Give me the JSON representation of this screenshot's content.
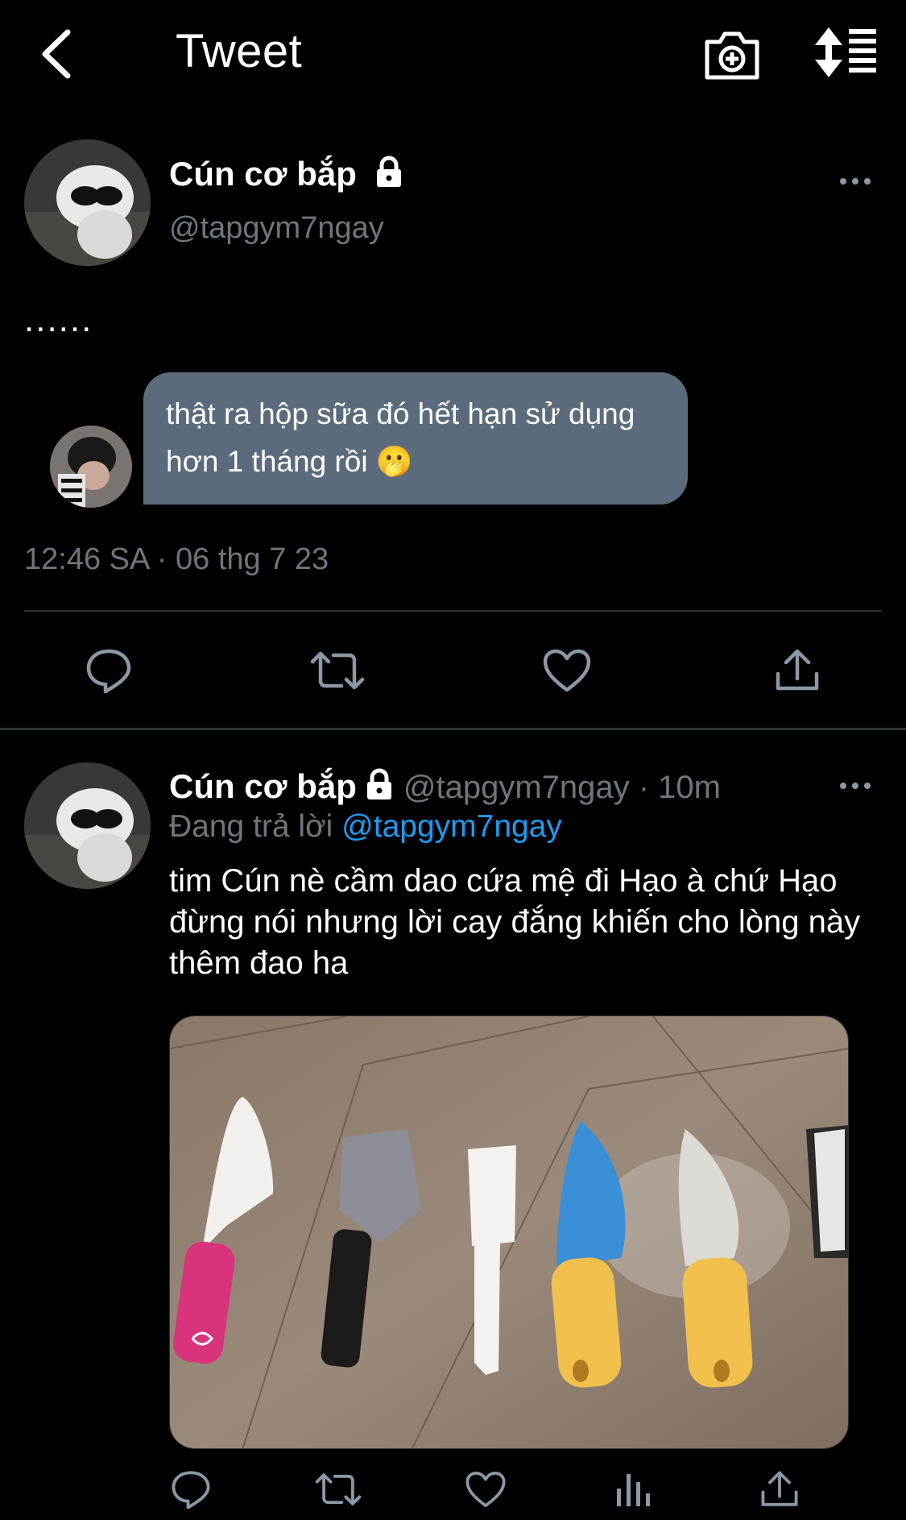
{
  "header": {
    "title": "Tweet"
  },
  "main_tweet": {
    "author_name": "Cún cơ bắp",
    "handle": "@tapgym7ngay",
    "text": "......",
    "dm_message": "thật ra hộp sữa đó hết hạn sử dụng hơn 1 tháng rồi 🫢",
    "timestamp": "12:46 SA · 06 thg 7 23"
  },
  "reply": {
    "author_name": "Cún cơ bắp",
    "meta": "@tapgym7ngay · 10m",
    "replying_label": "Đang trả lời ",
    "replying_to": "@tapgym7ngay",
    "text": "tim Cún nè cầm dao cứa mệ đi Hạo à chứ Hạo đừng nói nhưng lời cay đắng khiến cho lòng này thêm đao ha"
  },
  "colors": {
    "background": "#000000",
    "secondary_text": "#6e767d",
    "accent": "#1d9bf0",
    "divider": "#2f3336",
    "dm_bubble": "#5b6b7b"
  },
  "icons": {
    "header": [
      "chevron-left-icon",
      "camera-plus-icon",
      "sort-icon"
    ],
    "actions": [
      "reply-icon",
      "retweet-icon",
      "like-icon",
      "share-icon"
    ],
    "reply_actions": [
      "reply-icon",
      "retweet-icon",
      "like-icon",
      "analytics-icon",
      "share-icon"
    ]
  }
}
